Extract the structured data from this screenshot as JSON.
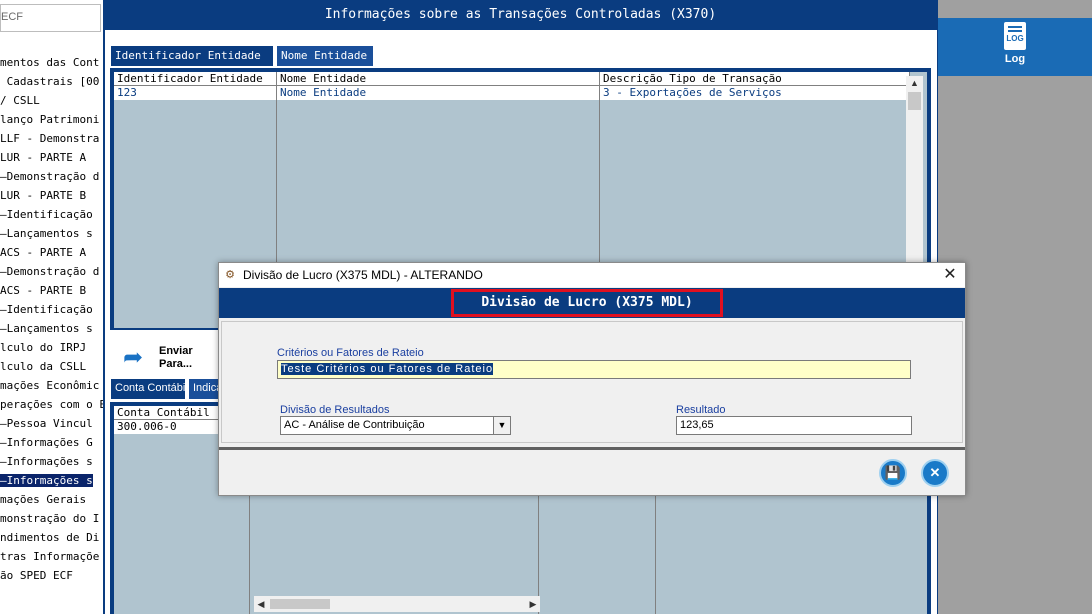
{
  "left_panel": {
    "search_text": "ECF",
    "tree_items": [
      "mentos das Cont",
      " Cadastrais [00",
      "/ CSLL",
      "lanço Patrimoni",
      "LLF - Demonstra",
      "LUR - PARTE A",
      "—Demonstração d",
      "LUR - PARTE B",
      "—Identificação",
      "—Lançamentos s",
      "ACS - PARTE A",
      "—Demonstração d",
      "ACS - PARTE B",
      "—Identificação",
      "—Lançamentos s",
      "lculo do IRPJ",
      "lculo da CSLL",
      "mações Econômic",
      "perações com o E",
      "—Pessoa Vincul",
      "—Informações G",
      "—Informações s",
      "—Informações s",
      "mações Gerais",
      "monstração do I",
      "ndimentos de Di",
      "tras Informaçõe",
      "ão SPED ECF"
    ],
    "selected_index": 22
  },
  "main_window": {
    "title": "Informações sobre as Transações Controladas (X370)",
    "tabs": [
      {
        "label": "Identificador Entidade",
        "active": true
      },
      {
        "label": "Nome Entidade",
        "active": false
      }
    ],
    "grid1": {
      "headers": [
        "Identificador Entidade",
        "Nome Entidade",
        "Descrição Tipo de Transação"
      ],
      "rows": [
        [
          "123",
          "Nome Entidade",
          "3 - Exportações de Serviços"
        ]
      ]
    },
    "send_button": {
      "line1": "Enviar",
      "line2": "Para..."
    },
    "tabs2": [
      {
        "label": "Conta Contábil",
        "active": true
      },
      {
        "label": "Indica",
        "active": false
      }
    ],
    "grid2": {
      "headers": [
        "Conta Contábil"
      ],
      "rows": [
        [
          "300.006-0"
        ]
      ]
    }
  },
  "right_panel": {
    "log_button_label": "Log",
    "log_icon_text": "LOG"
  },
  "dialog": {
    "title": "Divisão de Lucro (X375 MDL)   -  ALTERANDO",
    "header_title": "Divisão de Lucro (X375 MDL)",
    "fields": {
      "criterios_label": "Critérios ou Fatores de Rateio",
      "criterios_value": "Teste Critérios ou Fatores de Rateio",
      "divisao_label": "Divisão de Resultados",
      "divisao_value": "AC - Análise de Contribuição",
      "resultado_label": "Resultado",
      "resultado_value": "123,65"
    },
    "close_glyph": "✕",
    "save_glyph": "💾",
    "cancel_glyph": "✕"
  },
  "colors": {
    "navy": "#0a3c80",
    "grid_bg": "#b0c4cf",
    "highlight_border": "#e01020",
    "log_bar": "#1a6bb5"
  }
}
